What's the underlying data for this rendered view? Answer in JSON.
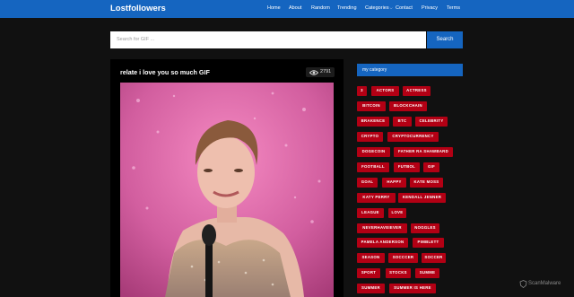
{
  "header": {
    "logo": "Lostfollowers",
    "nav": [
      "Home",
      "About",
      "Random",
      "Trending",
      "Categories",
      "Contact",
      "Privacy",
      "Terms"
    ]
  },
  "search": {
    "placeholder": "Search for GIF ...",
    "button": "Search"
  },
  "post": {
    "title": "relate i love you so much GIF",
    "views": "2791"
  },
  "sidebar": {
    "heading": "my category",
    "tags": [
      "3",
      "ACTORS",
      "ACTRESS",
      "BITCOIN",
      "BLOCKCHAIN",
      "BRAKENCE",
      "BTC",
      "CELEBRITY",
      "CRYPTO",
      "CRYPTOCURRENCY",
      "DOGECOIN",
      "FATHER RA SHAWBARD",
      "FOOTBALL",
      "FUTBOL",
      "GIF",
      "GOAL",
      "HAPPY",
      "KATE MOSS",
      "KATY PERRY",
      "KENDALL JENNER",
      "LEAGUE",
      "LOVE",
      "NEVERHAVEIEVER",
      "NOGGLES",
      "PAMELA ANDERSON",
      "PIMBLETT",
      "SEASON",
      "SOCCCER",
      "SOCCER",
      "SPORT",
      "STOCKS",
      "SUMME",
      "SUMMER",
      "SUMMER IS HERE"
    ]
  },
  "watermark": "ScanMalware",
  "colors": {
    "brand": "#1565c0",
    "tag": "#b30014",
    "background": "#111111"
  }
}
